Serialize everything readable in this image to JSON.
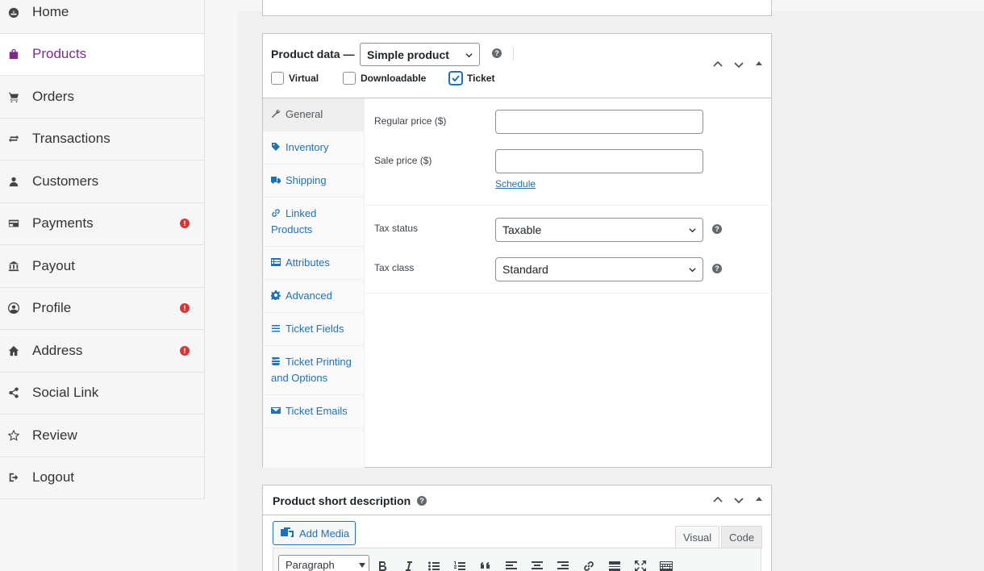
{
  "sidebar": {
    "items": [
      {
        "label": "Home",
        "icon": "dashboard-icon"
      },
      {
        "label": "Products",
        "icon": "bag-icon",
        "active": true
      },
      {
        "label": "Orders",
        "icon": "cart-icon"
      },
      {
        "label": "Transactions",
        "icon": "transfer-icon"
      },
      {
        "label": "Customers",
        "icon": "user-icon"
      },
      {
        "label": "Payments",
        "icon": "payment-icon",
        "alert": "!"
      },
      {
        "label": "Payout",
        "icon": "bank-icon"
      },
      {
        "label": "Profile",
        "icon": "profile-icon",
        "alert": "!"
      },
      {
        "label": "Address",
        "icon": "home-icon",
        "alert": "!"
      },
      {
        "label": "Social Link",
        "icon": "share-icon"
      },
      {
        "label": "Review",
        "icon": "star-icon"
      },
      {
        "label": "Logout",
        "icon": "logout-icon"
      }
    ]
  },
  "product_data": {
    "title": "Product data —",
    "type_select": "Simple product",
    "help": "?",
    "checkboxes": {
      "virtual": {
        "label": "Virtual",
        "checked": false
      },
      "downloadable": {
        "label": "Downloadable",
        "checked": false
      },
      "ticket": {
        "label": "Ticket",
        "checked": true
      }
    },
    "tabs": [
      {
        "label": "General",
        "active": true
      },
      {
        "label": "Inventory"
      },
      {
        "label": "Shipping"
      },
      {
        "label": "Linked Products"
      },
      {
        "label": "Attributes"
      },
      {
        "label": "Advanced"
      },
      {
        "label": "Ticket Fields"
      },
      {
        "label": "Ticket Printing and Options"
      },
      {
        "label": "Ticket Emails"
      }
    ],
    "fields": {
      "regular_price_label": "Regular price ($)",
      "regular_price_value": "",
      "sale_price_label": "Sale price ($)",
      "sale_price_value": "",
      "schedule_link": "Schedule",
      "tax_status_label": "Tax status",
      "tax_status_value": "Taxable",
      "tax_class_label": "Tax class",
      "tax_class_value": "Standard"
    }
  },
  "short_description": {
    "title": "Product short description",
    "help": "?",
    "add_media": "Add Media",
    "tab_visual": "Visual",
    "tab_code": "Code",
    "format_select": "Paragraph"
  },
  "colors": {
    "accent": "#7b2b8c",
    "link": "#2271b1",
    "alert": "#d63638"
  }
}
